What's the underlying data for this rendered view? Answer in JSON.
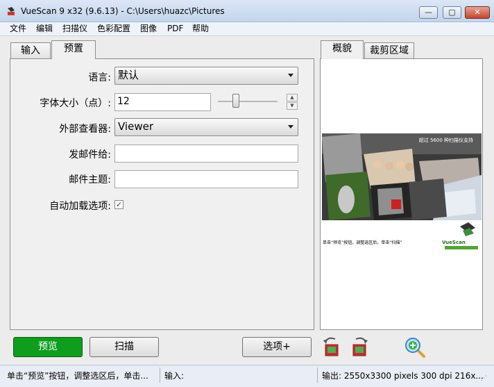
{
  "window": {
    "title": "VueScan 9 x32 (9.6.13) - C:\\Users\\huazc\\Pictures",
    "min_glyph": "—",
    "max_glyph": "▢",
    "close_glyph": "✕"
  },
  "menu": [
    "文件",
    "编辑",
    "扫描仪",
    "色彩配置",
    "图像",
    "PDF",
    "帮助"
  ],
  "left_tabs": [
    {
      "label": "输入",
      "active": false
    },
    {
      "label": "预置",
      "active": true
    }
  ],
  "right_tabs": [
    {
      "label": "概貌",
      "active": true
    },
    {
      "label": "裁剪区域",
      "active": false
    }
  ],
  "form": {
    "language_label": "语言:",
    "language_value": "默认",
    "font_size_label": "字体大小（点）:",
    "font_size_value": "12",
    "font_size_slider_level": 0.3,
    "viewer_label": "外部查看器:",
    "viewer_value": "Viewer",
    "email_to_label": "发邮件给:",
    "email_to_value": "",
    "email_subject_label": "邮件主题:",
    "email_subject_value": "",
    "autoload_label": "自动加载选项:",
    "autoload_checked": true
  },
  "preview": {
    "banner_text": "超过 5600 种扫描仪支持",
    "footer_text": "单击“预览”按钮，调整选区后，单击“扫描”",
    "logo_text": "VueScan"
  },
  "buttons": {
    "preview": "预览",
    "scan": "扫描",
    "options": "选项+"
  },
  "status": {
    "hint": "单击“预览”按钮，调整选区后，单击...",
    "input": "输入:",
    "output": "输出: 2550x3300 pixels 300 dpi 216x..."
  },
  "colors": {
    "preview_button": "#0f9d1e",
    "accent": "#c9d9ee"
  }
}
